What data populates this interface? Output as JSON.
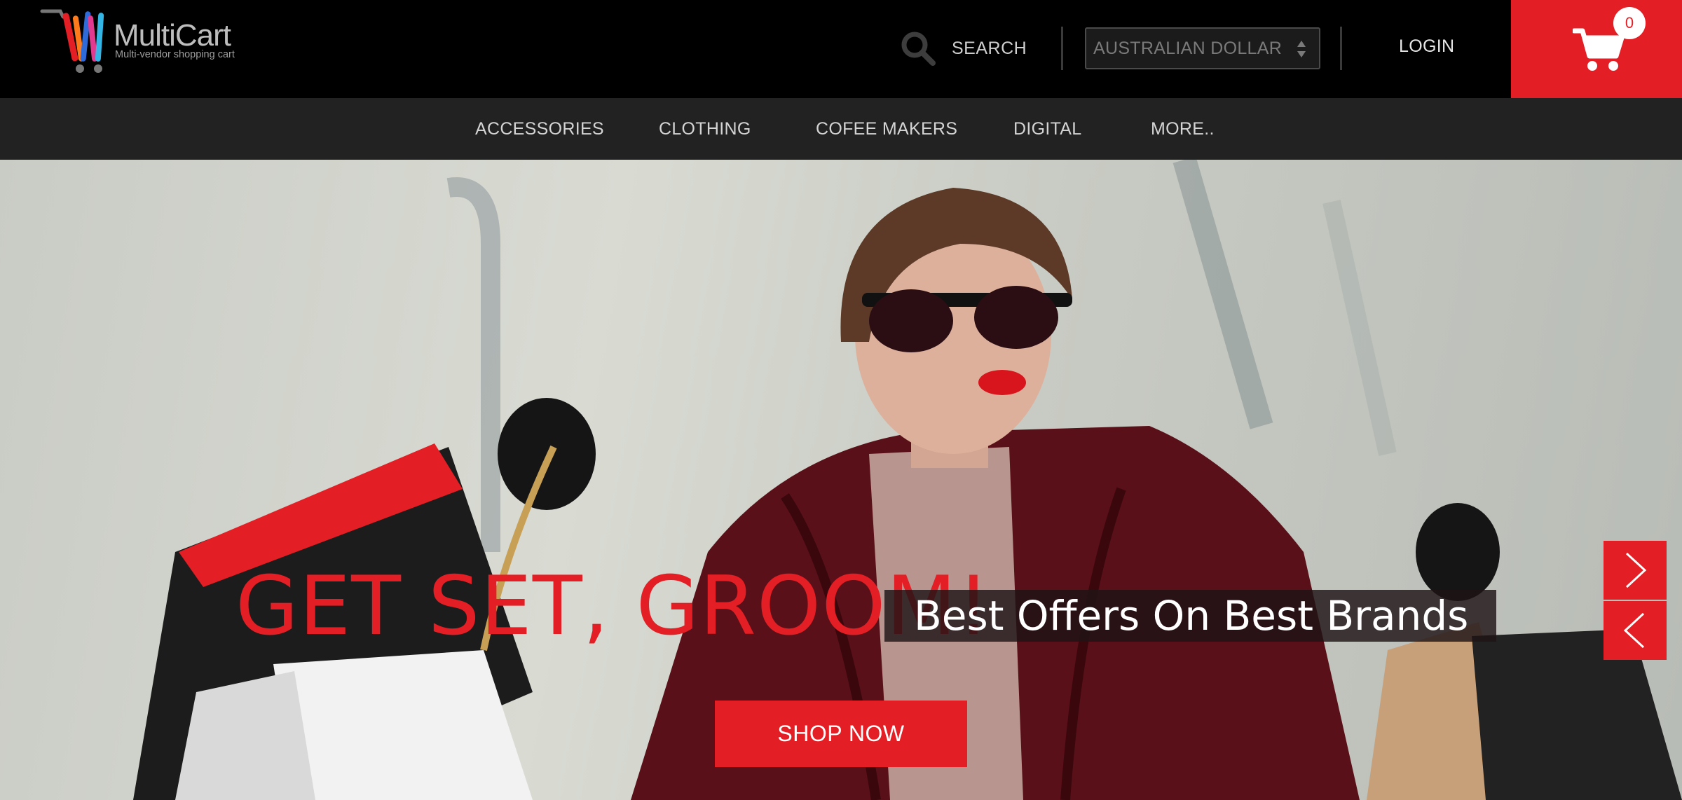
{
  "header": {
    "logo": {
      "name": "MultiCart",
      "tagline": "Multi-vendor shopping cart"
    },
    "search": {
      "label": "SEARCH",
      "icon": "search-icon"
    },
    "currency": {
      "selected": "AUSTRALIAN DOLLAR"
    },
    "login_label": "LOGIN",
    "cart": {
      "count": "0",
      "icon": "cart-icon"
    }
  },
  "nav": {
    "items": [
      {
        "label": "ACCESSORIES"
      },
      {
        "label": "CLOTHING"
      },
      {
        "label": "COFEE MAKERS"
      },
      {
        "label": "DIGITAL"
      },
      {
        "label": "MORE.."
      }
    ]
  },
  "hero": {
    "headline": "GET SET, GROOM!",
    "subline": "Best Offers On Best Brands",
    "cta_label": "SHOP NOW",
    "next_icon": "chevron-right-icon",
    "prev_icon": "chevron-left-icon"
  },
  "colors": {
    "brand_red": "#e31e24",
    "topbar": "#000000",
    "navbar": "#222222"
  }
}
